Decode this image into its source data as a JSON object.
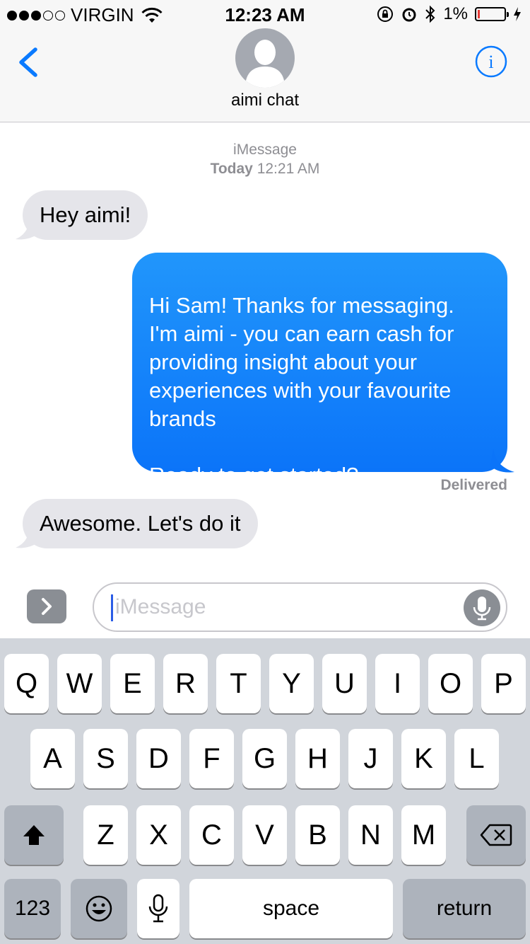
{
  "status_bar": {
    "carrier": "VIRGIN",
    "time": "12:23 AM",
    "battery_percent": "1%",
    "signal_bars_filled": 3,
    "signal_bars_total": 5
  },
  "header": {
    "contact_name": "aimi chat",
    "back_icon": "chevron-left-icon",
    "info_icon": "info-icon"
  },
  "thread": {
    "service": "iMessage",
    "date_label": "Today",
    "time_label": "12:21 AM",
    "messages": [
      {
        "direction": "incoming",
        "text": "Hey aimi!"
      },
      {
        "direction": "outgoing",
        "text": "Hi Sam! Thanks for messaging.\nI'm aimi - you can earn cash for providing insight about your experiences with your favourite brands\n\nReady to get started?"
      },
      {
        "direction": "incoming",
        "text": "Awesome. Let's do it"
      }
    ],
    "delivered_label": "Delivered"
  },
  "composer": {
    "placeholder": "iMessage"
  },
  "keyboard": {
    "row1": [
      "Q",
      "W",
      "E",
      "R",
      "T",
      "Y",
      "U",
      "I",
      "O",
      "P"
    ],
    "row2": [
      "A",
      "S",
      "D",
      "F",
      "G",
      "H",
      "J",
      "K",
      "L"
    ],
    "row3": [
      "Z",
      "X",
      "C",
      "V",
      "B",
      "N",
      "M"
    ],
    "numbers_label": "123",
    "space_label": "space",
    "return_label": "return"
  },
  "colors": {
    "accent": "#0a7aff",
    "outgoing_bubble": "#1a82fb",
    "incoming_bubble": "#e5e5ea"
  }
}
